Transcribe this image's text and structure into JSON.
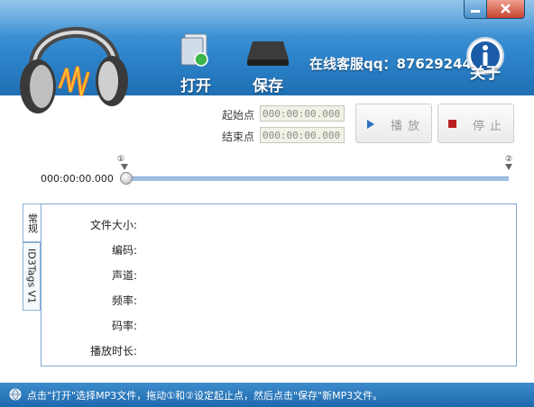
{
  "toolbar": {
    "open_label": "打开",
    "save_label": "保存",
    "service_text": "在线客服qq：876292449",
    "about_label": "关于"
  },
  "range": {
    "start_label": "起始点",
    "end_label": "结束点",
    "start_value": "000:00:00.000",
    "end_value": "000:00:00.000"
  },
  "playback": {
    "play_label": "播放",
    "stop_label": "停止",
    "current_time": "000:00:00.000",
    "marker_start": "①",
    "marker_end": "②"
  },
  "tabs": [
    {
      "label": "常规"
    },
    {
      "label": "ID3Tags V1"
    }
  ],
  "info": {
    "file_size": "文件大小:",
    "encoding": "编码:",
    "channel": "声道:",
    "frequency": "频率:",
    "bitrate": "码率:",
    "duration": "播放时长:"
  },
  "status": {
    "text": "点击\"打开\"选择MP3文件，拖动①和②设定起止点，然后点击\"保存\"新MP3文件。"
  },
  "icons": {
    "logo": "headphones-logo-icon",
    "open": "open-file-icon",
    "save": "save-drive-icon",
    "about": "info-icon",
    "status": "globe-icon"
  }
}
